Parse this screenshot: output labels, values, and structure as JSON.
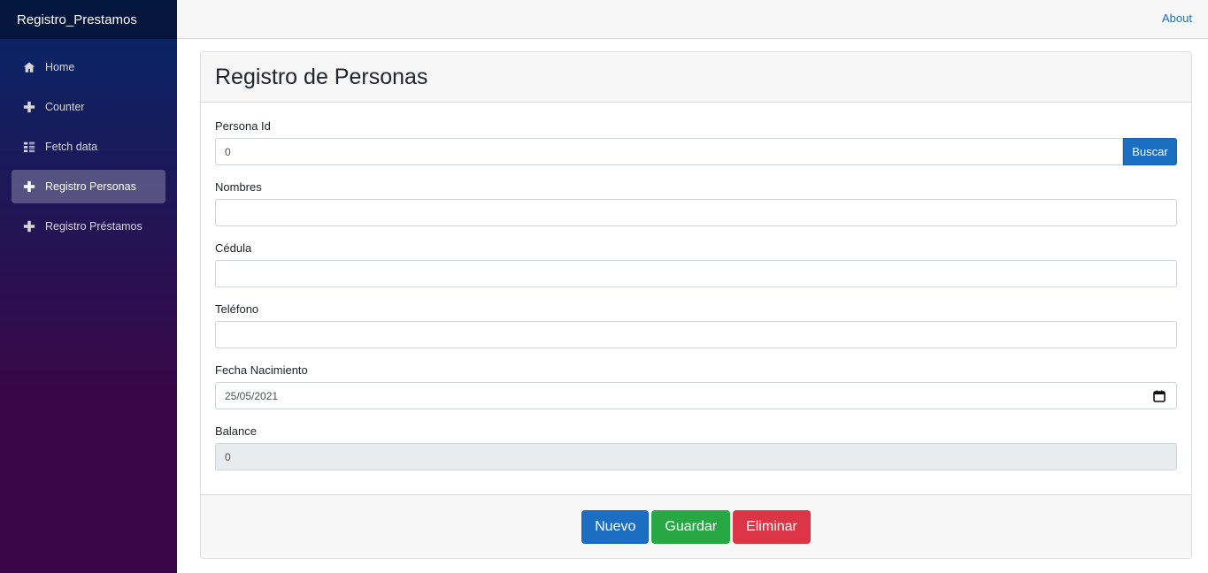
{
  "app": {
    "brand": "Registro_Prestamos"
  },
  "sidebar": {
    "items": [
      {
        "label": "Home",
        "icon": "home-icon",
        "active": false
      },
      {
        "label": "Counter",
        "icon": "plus-icon",
        "active": false
      },
      {
        "label": "Fetch data",
        "icon": "list-icon",
        "active": false
      },
      {
        "label": "Registro Personas",
        "icon": "plus-icon",
        "active": true
      },
      {
        "label": "Registro Préstamos",
        "icon": "plus-icon",
        "active": false
      }
    ]
  },
  "topbar": {
    "about_label": "About"
  },
  "form": {
    "title": "Registro de Personas",
    "persona_id": {
      "label": "Persona Id",
      "value": "0"
    },
    "buscar_label": "Buscar",
    "nombres": {
      "label": "Nombres",
      "value": ""
    },
    "cedula": {
      "label": "Cédula",
      "value": ""
    },
    "telefono": {
      "label": "Teléfono",
      "value": ""
    },
    "fecha_nacimiento": {
      "label": "Fecha Nacimiento",
      "value": "25/05/2021"
    },
    "balance": {
      "label": "Balance",
      "value": "0"
    }
  },
  "footer": {
    "nuevo_label": "Nuevo",
    "guardar_label": "Guardar",
    "eliminar_label": "Eliminar"
  },
  "colors": {
    "primary": "#1b6ec2",
    "success": "#28a745",
    "danger": "#dc3545",
    "sidebar_top": "#052767",
    "sidebar_bottom": "#3a0647"
  }
}
